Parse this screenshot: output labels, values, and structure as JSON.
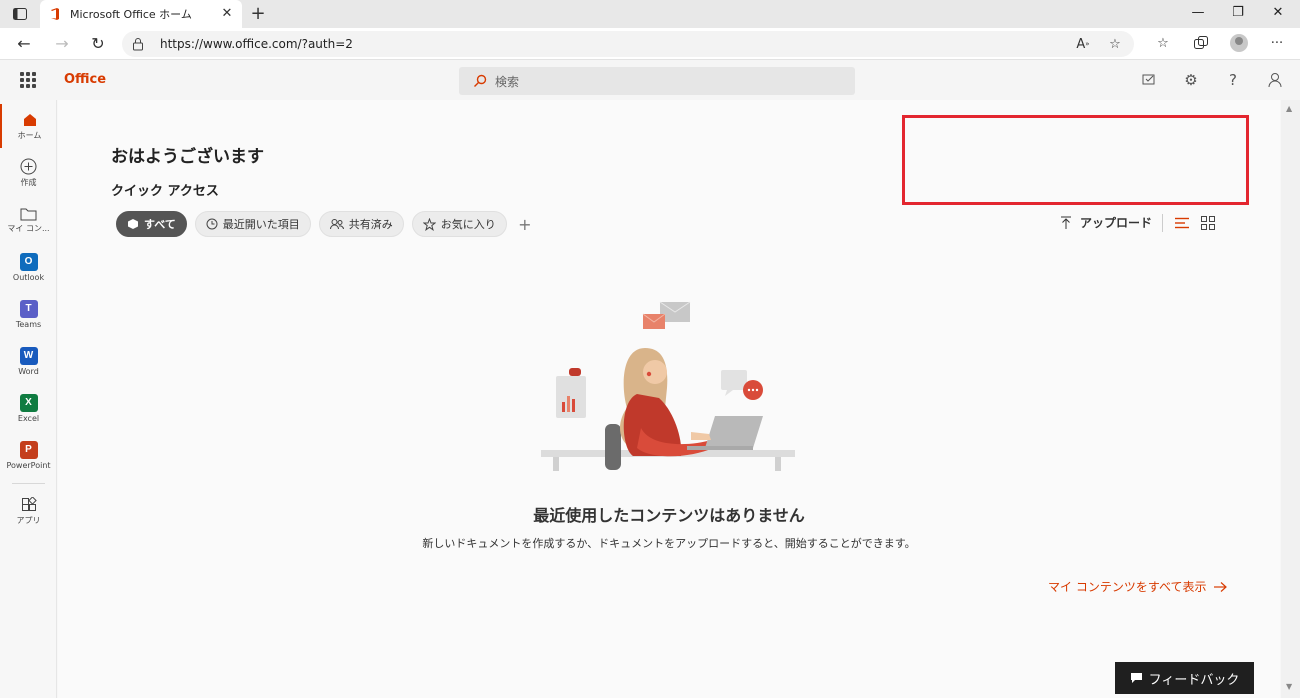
{
  "browser": {
    "tab_title": "Microsoft Office ホーム",
    "url": "https://www.office.com/?auth=2"
  },
  "header": {
    "brand": "Office",
    "search_placeholder": "検索"
  },
  "rail": {
    "items": [
      {
        "label": "ホーム",
        "icon": "home-icon"
      },
      {
        "label": "作成",
        "icon": "plus-circle-icon"
      },
      {
        "label": "マイ コン...",
        "icon": "folder-icon"
      },
      {
        "label": "Outlook",
        "icon": "outlook-icon"
      },
      {
        "label": "Teams",
        "icon": "teams-icon"
      },
      {
        "label": "Word",
        "icon": "word-icon"
      },
      {
        "label": "Excel",
        "icon": "excel-icon"
      },
      {
        "label": "PowerPoint",
        "icon": "powerpoint-icon"
      },
      {
        "label": "アプリ",
        "icon": "apps-icon"
      }
    ]
  },
  "main": {
    "greeting": "おはようございます",
    "quick_access": "クイック アクセス",
    "filters": [
      {
        "label": "すべて",
        "active": true
      },
      {
        "label": "最近開いた項目",
        "active": false
      },
      {
        "label": "共有済み",
        "active": false
      },
      {
        "label": "お気に入り",
        "active": false
      }
    ],
    "upload": "アップロード",
    "empty_title": "最近使用したコンテンツはありません",
    "empty_desc": "新しいドキュメントを作成するか、ドキュメントをアップロードすると、開始することができます。",
    "see_all": "マイ コンテンツをすべて表示"
  },
  "feedback": "フィードバック",
  "colors": {
    "accent": "#d83b01",
    "highlight": "#e3262f"
  }
}
